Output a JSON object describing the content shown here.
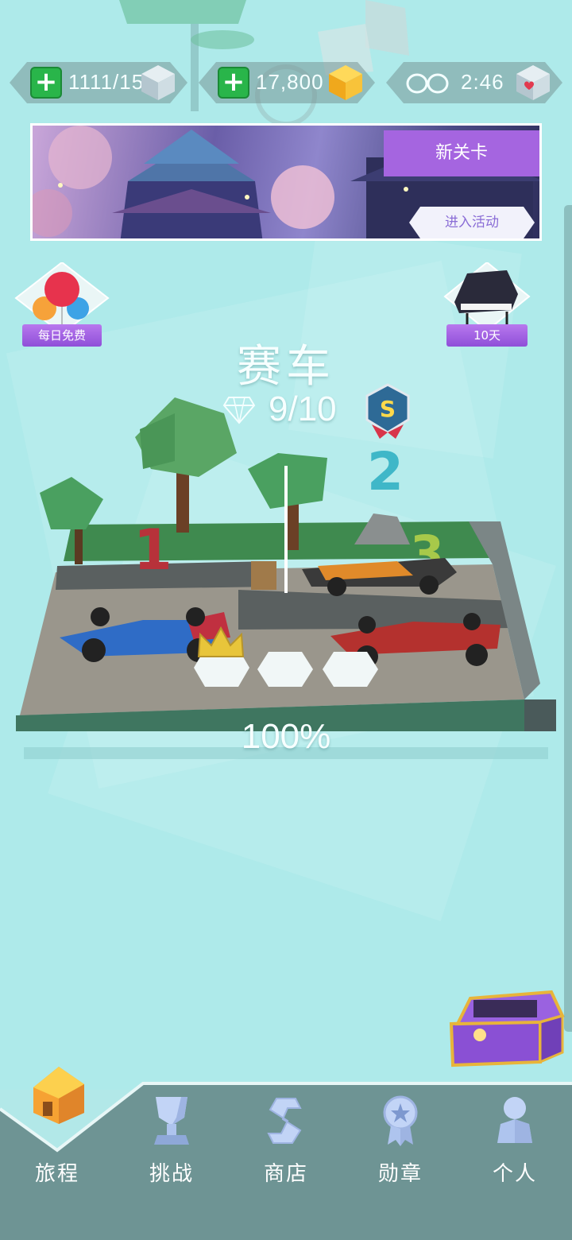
{
  "top_bar": {
    "lives": "1111/15",
    "coins": "17,800",
    "timer": "2:46"
  },
  "banner": {
    "new_level_label": "新关卡",
    "enter_event_label": "进入活动"
  },
  "side_rewards": {
    "daily_free_label": "每日免费",
    "piano_days_label": "10天"
  },
  "level": {
    "title": "赛车",
    "gems_progress": "9/10",
    "rank_badge": "S",
    "completion": "100%"
  },
  "scene_numbers": [
    "1",
    "2",
    "3"
  ],
  "bottom_nav": {
    "items": [
      {
        "label": "旅程",
        "icon": "house-icon",
        "active": true
      },
      {
        "label": "挑战",
        "icon": "trophy-icon"
      },
      {
        "label": "商店",
        "icon": "shop-s-icon"
      },
      {
        "label": "勋章",
        "icon": "medal-icon"
      },
      {
        "label": "个人",
        "icon": "person-icon"
      }
    ]
  },
  "colors": {
    "background": "#aeeaea",
    "nav_bar": "#6e9494",
    "accent_purple": "#a565e0",
    "plus_green": "#29b54a"
  }
}
